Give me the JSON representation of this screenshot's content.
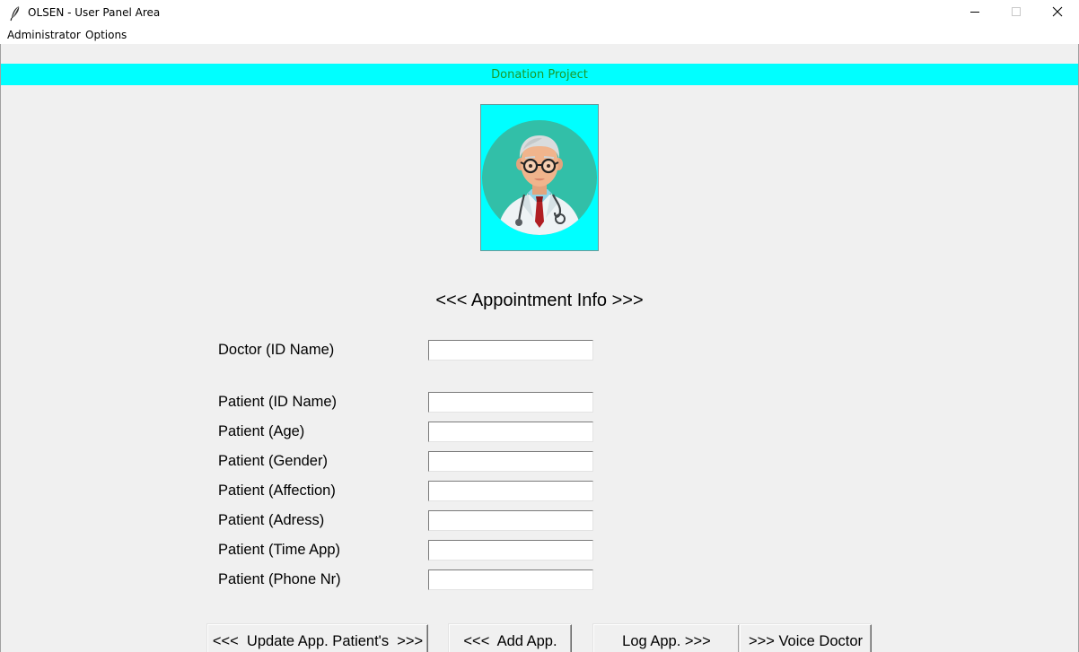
{
  "window": {
    "title": "OLSEN - User Panel Area",
    "app_icon": "feather-icon",
    "controls": [
      "minimize-icon",
      "maximize-icon",
      "close-icon"
    ]
  },
  "menubar": {
    "items": [
      {
        "label": "Administrator"
      },
      {
        "label": "Options"
      }
    ]
  },
  "banner": {
    "text": "Donation Project",
    "background": "#00ffff",
    "text_color": "#1a9a2a"
  },
  "avatar": {
    "icon": "doctor-avatar-icon",
    "background": "#00ffff",
    "circle_color": "#32bfa8"
  },
  "form": {
    "heading": "<<< Appointment Info >>>",
    "fields": [
      {
        "label": "Doctor (ID Name)",
        "value": "",
        "placeholder": ""
      },
      {
        "label": "Patient (ID Name)",
        "value": "",
        "placeholder": ""
      },
      {
        "label": "Patient (Age)",
        "value": "",
        "placeholder": ""
      },
      {
        "label": "Patient (Gender)",
        "value": "",
        "placeholder": ""
      },
      {
        "label": "Patient (Affection)",
        "value": "",
        "placeholder": ""
      },
      {
        "label": "Patient (Adress)",
        "value": "",
        "placeholder": ""
      },
      {
        "label": "Patient (Time App)",
        "value": "",
        "placeholder": ""
      },
      {
        "label": "Patient (Phone Nr)",
        "value": "",
        "placeholder": ""
      }
    ]
  },
  "buttons": {
    "update": "<<<  Update App. Patient's  >>>",
    "add": "<<<  Add App.",
    "log": "Log App. >>>",
    "voice": ">>> Voice Doctor"
  }
}
